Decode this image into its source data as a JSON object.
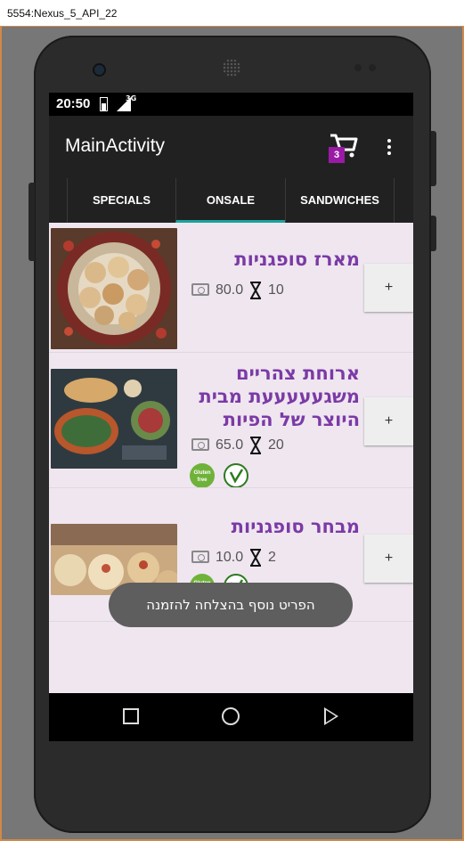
{
  "window": {
    "title": "5554:Nexus_5_API_22"
  },
  "status_bar": {
    "time": "20:50",
    "network": "3G"
  },
  "app_bar": {
    "title": "MainActivity",
    "cart_count": "3"
  },
  "tabs": [
    {
      "label": "SPECIALS",
      "active": false
    },
    {
      "label": "ONSALE",
      "active": true
    },
    {
      "label": "SANDWICHES",
      "active": false
    }
  ],
  "items": [
    {
      "name": "מארז סופגניות",
      "price": "80.0",
      "prep_time": "10",
      "badges": [],
      "add_label": "+"
    },
    {
      "name": "ארוחת צהריים משגעעעעעת מבית היוצר של הפיות",
      "price": "65.0",
      "prep_time": "20",
      "badges": [
        "gluten-free",
        "vegan"
      ],
      "add_label": "+"
    },
    {
      "name": "מבחר סופגניות",
      "price": "10.0",
      "prep_time": "2",
      "badges": [
        "gluten-free",
        "vegan"
      ],
      "add_label": "+"
    }
  ],
  "gluten_free_badge": {
    "line1": "Gluten",
    "line2": "free"
  },
  "toast": {
    "message": "הפריט נוסף בהצלחה להזמנה"
  },
  "colors": {
    "accent": "#1aa39b",
    "item_title": "#7b3aa6",
    "badge": "#9a1aa6",
    "app_bar": "#212121"
  },
  "icons": {
    "cart": "cart-icon",
    "overflow": "overflow-menu-icon",
    "price": "money-icon",
    "time": "hourglass-icon"
  }
}
